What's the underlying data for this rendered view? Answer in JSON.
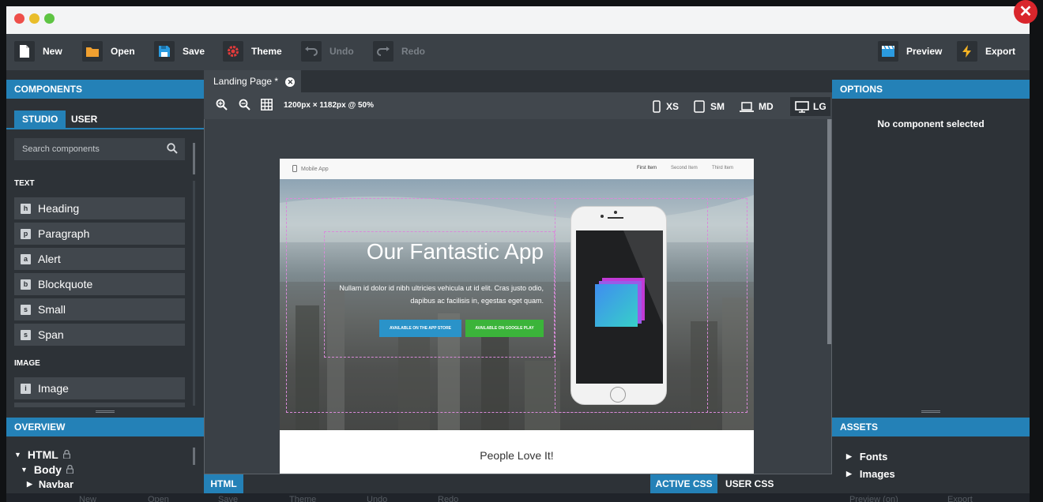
{
  "toolbar": {
    "new": "New",
    "open": "Open",
    "save": "Save",
    "theme": "Theme",
    "undo": "Undo",
    "redo": "Redo",
    "preview": "Preview",
    "export": "Export"
  },
  "components_panel": {
    "title": "COMPONENTS",
    "tabs": [
      "STUDIO",
      "USER"
    ],
    "search_placeholder": "Search components",
    "categories": {
      "text": "TEXT",
      "image": "IMAGE"
    },
    "text_items": [
      {
        "badge": "h",
        "label": "Heading"
      },
      {
        "badge": "p",
        "label": "Paragraph"
      },
      {
        "badge": "a",
        "label": "Alert"
      },
      {
        "badge": "b",
        "label": "Blockquote"
      },
      {
        "badge": "s",
        "label": "Small"
      },
      {
        "badge": "s",
        "label": "Span"
      }
    ],
    "image_items": [
      {
        "badge": "i",
        "label": "Image"
      }
    ]
  },
  "overview_panel": {
    "title": "OVERVIEW",
    "items": [
      "HTML",
      "Body",
      "Navbar"
    ]
  },
  "document": {
    "tab_label": "Landing Page *",
    "canvas_info": "1200px × 1182px @ 50%",
    "breakpoints": [
      "XS",
      "SM",
      "MD",
      "LG"
    ],
    "active_breakpoint": "LG"
  },
  "preview_page": {
    "brand": "Mobile App",
    "nav": [
      "First Item",
      "Second Item",
      "Third Item"
    ],
    "hero_title": "Our Fantastic App",
    "hero_text": "Nullam id dolor id nibh ultricies vehicula ut id elit. Cras justo odio, dapibus ac facilisis in, egestas eget quam.",
    "app_store_btn": "AVAILABLE ON THE APP STORE",
    "google_play_btn": "AVAILABLE ON GOOGLE PLAY",
    "section_title": "People Love It!"
  },
  "options_panel": {
    "title": "OPTIONS",
    "empty_text": "No component selected"
  },
  "assets_panel": {
    "title": "ASSETS",
    "items": [
      "Fonts",
      "Images"
    ]
  },
  "bottom": {
    "html_tab": "HTML",
    "active_css_tab": "ACTIVE CSS",
    "user_css_tab": "USER CSS"
  },
  "ghost_toolbar": {
    "new": "New",
    "open": "Open",
    "save": "Save",
    "theme": "Theme",
    "undo": "Undo",
    "redo": "Redo",
    "preview": "Preview (on)",
    "export": "Export"
  },
  "colors": {
    "accent": "#2481b7",
    "panel": "#2d3237",
    "close": "#d9262c"
  }
}
